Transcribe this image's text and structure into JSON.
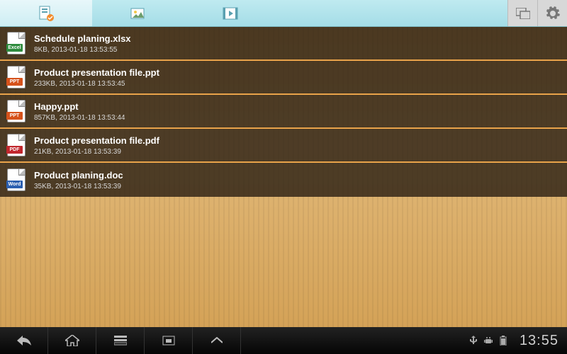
{
  "tabs": [
    {
      "icon": "documents-icon"
    },
    {
      "icon": "images-icon"
    },
    {
      "icon": "videos-icon"
    }
  ],
  "files": [
    {
      "name": "Schedule planing.xlsx",
      "meta": "8KB, 2013-01-18 13:53:55",
      "badge": "Excel",
      "cls": "b-excel"
    },
    {
      "name": "Product presentation file.ppt",
      "meta": "233KB, 2013-01-18 13:53:45",
      "badge": "PPT",
      "cls": "b-ppt"
    },
    {
      "name": "Happy.ppt",
      "meta": "857KB, 2013-01-18 13:53:44",
      "badge": "PPT",
      "cls": "b-ppt"
    },
    {
      "name": "Product presentation file.pdf",
      "meta": "21KB, 2013-01-18 13:53:39",
      "badge": "PDF",
      "cls": "b-pdf"
    },
    {
      "name": "Product planing.doc",
      "meta": "35KB, 2013-01-18 13:53:39",
      "badge": "Word",
      "cls": "b-word"
    }
  ],
  "status": {
    "clock": "13:55"
  }
}
